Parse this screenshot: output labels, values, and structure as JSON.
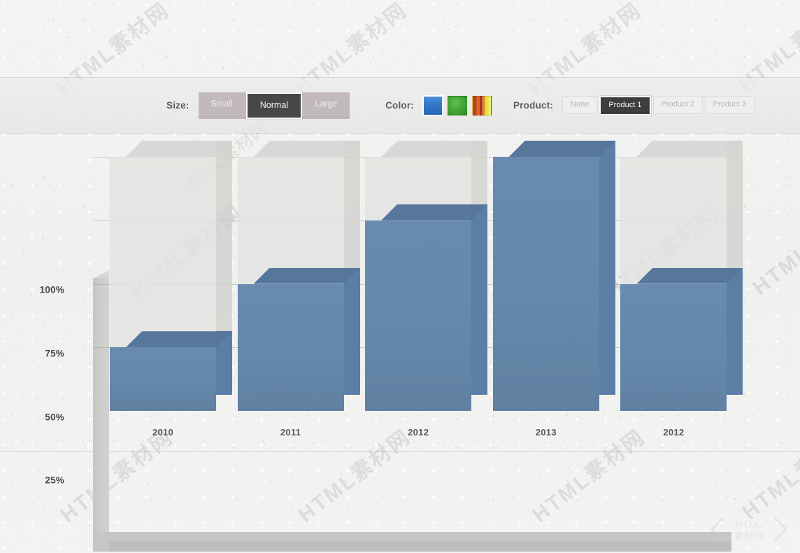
{
  "toolbar": {
    "size": {
      "label": "Size:",
      "options": [
        "Small",
        "Normal",
        "Large"
      ],
      "selected": "Normal"
    },
    "color": {
      "label": "Color:",
      "options": [
        {
          "name": "blue-swatch",
          "hex": "#2f72c7"
        },
        {
          "name": "green-swatch",
          "hex": "#3a9c2f"
        },
        {
          "name": "rainbow-swatch",
          "hex": "#c43a2a"
        }
      ],
      "selected": "blue-swatch"
    },
    "product": {
      "label": "Product:",
      "options": [
        "None",
        "Product 1",
        "Product 2",
        "Product 3"
      ],
      "selected": "Product 1"
    }
  },
  "chart_data": {
    "type": "bar",
    "title": "",
    "xlabel": "",
    "ylabel": "",
    "categories": [
      "2010",
      "2011",
      "2012",
      "2013",
      "2012"
    ],
    "values": [
      25,
      50,
      75,
      100,
      50
    ],
    "value_suffix": "%",
    "ylim": [
      0,
      110
    ],
    "yticks": [
      25,
      50,
      75,
      100
    ],
    "ytick_labels": [
      "25%",
      "50%",
      "75%",
      "100%"
    ],
    "grid": true,
    "legend": "none",
    "style": "3d-bars-with-100pct-track",
    "series": [
      {
        "name": "Product 1",
        "values": [
          25,
          50,
          75,
          100,
          50
        ],
        "color": "#5b81a7"
      }
    ],
    "track_color": "#e2e2e0",
    "track_max": 100
  },
  "watermark": {
    "text": "HTML素材网",
    "corner": "HTML素材网"
  }
}
